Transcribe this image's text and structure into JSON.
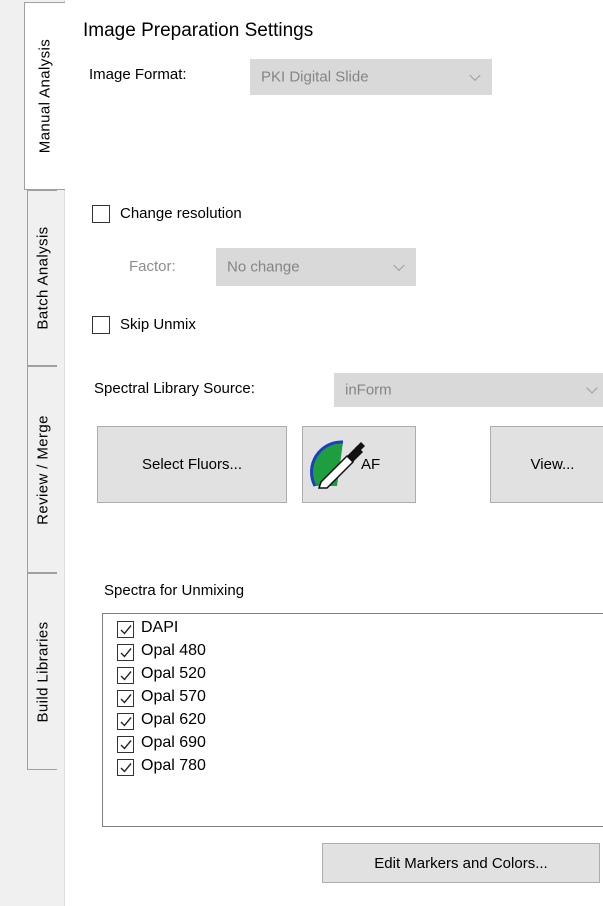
{
  "tabs": [
    {
      "label": "Manual Analysis",
      "active": true
    },
    {
      "label": "Batch Analysis",
      "active": false
    },
    {
      "label": "Review / Merge",
      "active": false
    },
    {
      "label": "Build Libraries",
      "active": false
    }
  ],
  "panel": {
    "title": "Image Preparation Settings",
    "image_format": {
      "label": "Image Format:",
      "value": "PKI Digital Slide"
    },
    "change_resolution": {
      "label": "Change resolution",
      "checked": false
    },
    "factor": {
      "label": "Factor:",
      "value": "No change"
    },
    "skip_unmix": {
      "label": "Skip Unmix",
      "checked": false
    },
    "spectral_library": {
      "label": "Spectral Library Source:",
      "value": "inForm"
    },
    "buttons": {
      "select_fluors": "Select Fluors...",
      "af": "AF",
      "view": "View..."
    },
    "spectra": {
      "label": "Spectra for Unmixing",
      "items": [
        {
          "name": "DAPI",
          "checked": true
        },
        {
          "name": "Opal 480",
          "checked": true
        },
        {
          "name": "Opal 520",
          "checked": true
        },
        {
          "name": "Opal 570",
          "checked": true
        },
        {
          "name": "Opal 620",
          "checked": true
        },
        {
          "name": "Opal 690",
          "checked": true
        },
        {
          "name": "Opal 780",
          "checked": true
        }
      ]
    },
    "edit_markers_button": "Edit Markers and Colors..."
  }
}
